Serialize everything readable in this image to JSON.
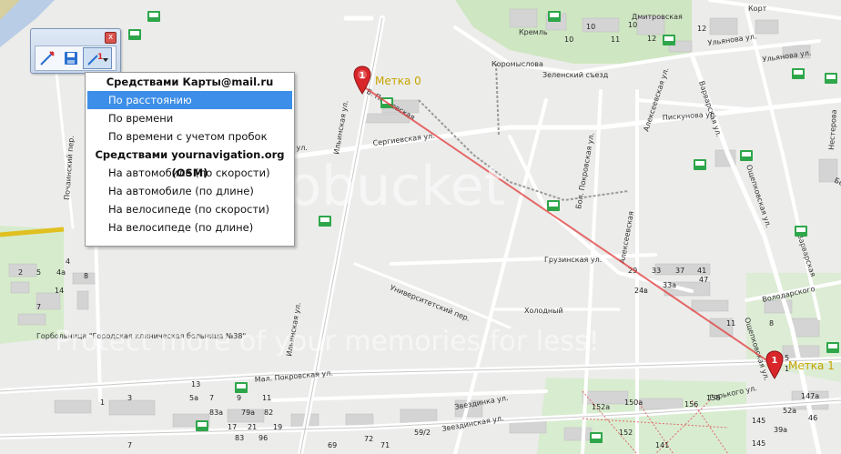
{
  "map": {
    "markers": [
      {
        "label": "Метка 0",
        "number": "1"
      },
      {
        "label": "Метка 1",
        "number": "1"
      }
    ],
    "streets": {
      "bolshaya_pokrovskaya": "Б. Покровская",
      "sergievskaya": "Сергиевская ул.",
      "ilyinskaya": "Ильинская ул.",
      "alekseevskaya_top": "Алексеевская ул.",
      "alekseevskaya_mid": "Алексеевская",
      "bol_pokrovskaya": "Бол. Покровская ул.",
      "piskunova": "Пискунова ул.",
      "varvarskaya": "Варварская ул.",
      "varvarskaya2": "Варварская",
      "oshchepkova": "Ощепковская ул.",
      "gruzinskaya": "Грузинская ул.",
      "universitetsky": "Университетский пер.",
      "kholodny": "Холодный",
      "mal_pokrovskaya": "Мал. Покровская ул.",
      "zvezdinka": "Звездинка ул.",
      "zvezdinka2": "Звездинская ул.",
      "gorkogo": "Горького ул.",
      "volodarskogo": "Володарского",
      "dmitrovskaya": "Дмитровская",
      "ulyanova": "Ульянова ул.",
      "kremlin": "Кремль",
      "koromyslova": "Коромыслова",
      "zelensky": "Зеленский съезд",
      "pochainsky": "Почаинский пер.",
      "nesterova": "Нестерова",
      "belinskogo": "Белинского",
      "kort": "Корт",
      "gorkogo_pl": "Горького пл."
    },
    "places": {
      "hospital": "Горбольница \"Городская клиническая больница №38\""
    },
    "house_numbers": [
      "10",
      "10",
      "10",
      "11",
      "12",
      "12",
      "4",
      "5",
      "14",
      "7",
      "4а",
      "8",
      "2",
      "1",
      "3",
      "5а",
      "7",
      "9",
      "11",
      "13",
      "19",
      "17",
      "21",
      "79а",
      "83а",
      "83",
      "82",
      "96",
      "29",
      "33",
      "37",
      "41",
      "24в",
      "33а",
      "47",
      "11",
      "8",
      "5",
      "1",
      "147а",
      "52а",
      "46",
      "39а",
      "145",
      "145",
      "150а",
      "152",
      "152а",
      "156",
      "158",
      "141",
      "59/2",
      "72",
      "71",
      "69",
      "23",
      "7"
    ]
  },
  "toolbar": {
    "close_label": "x",
    "icons": [
      "route-line-icon",
      "save-icon",
      "route-menu-icon"
    ]
  },
  "menu": {
    "group1_header": "Средствами Карты@mail.ru",
    "group1_items": [
      "По расстоянию",
      "По времени",
      "По времени с учетом пробок"
    ],
    "group2_header": "Средствами yournavigation.org (OSM)",
    "group2_items": [
      "На автомобиле (по скорости)",
      "На автомобиле (по длине)",
      "На велосипеде (по скорости)",
      "На велосипеде (по длине)"
    ],
    "selected_item": "По расстоянию"
  },
  "watermark": {
    "top": "photobucket",
    "bottom": "Protect more of your memories for less!"
  },
  "colors": {
    "route_line": "#e23b3b",
    "marker_red": "#d9262a",
    "marker_label": "#c8a400",
    "menu_highlight": "#3d8ee8",
    "park_green": "#cfe6c2",
    "water": "#b9cde6",
    "building": "#d4d4d4"
  }
}
